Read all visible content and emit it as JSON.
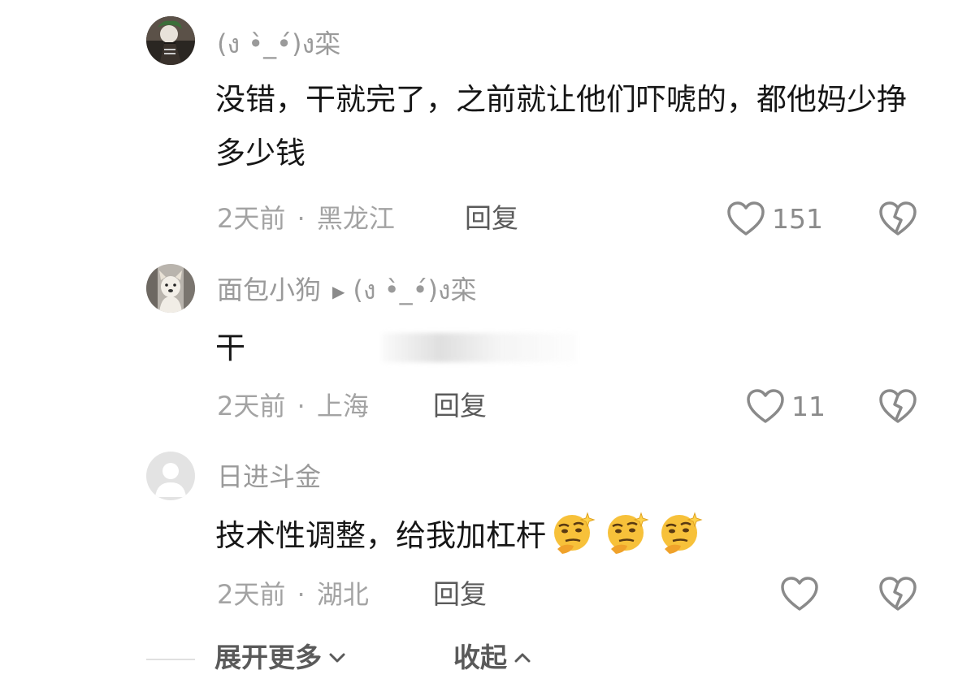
{
  "comments": [
    {
      "username": "(ง •̀_•́)ง栾",
      "reply_to": "",
      "text": "没错，干就完了，之前就让他们吓唬的，都他妈少挣多少钱",
      "time": "2天前",
      "location": "黑龙江",
      "reply_label": "回复",
      "likes": "151",
      "avatar": "joker-avatar"
    },
    {
      "username": "面包小狗",
      "reply_to": "(ง •̀_•́)ง栾",
      "text": "干",
      "time": "2天前",
      "location": "上海",
      "reply_label": "回复",
      "likes": "11",
      "avatar": "dog-avatar"
    },
    {
      "username": "日进斗金",
      "reply_to": "",
      "text": "技术性调整，给我加杠杆",
      "time": "2天前",
      "location": "湖北",
      "reply_label": "回复",
      "likes": "",
      "avatar": "default-avatar",
      "emojis": [
        "thinking-smirk-emoji",
        "thinking-smirk-emoji",
        "thinking-smirk-emoji"
      ]
    }
  ],
  "footer": {
    "expand_label": "展开更多",
    "collapse_label": "收起"
  },
  "colors": {
    "text": "#161616",
    "muted": "#9a9a9a",
    "reply": "#5a5a5a"
  }
}
